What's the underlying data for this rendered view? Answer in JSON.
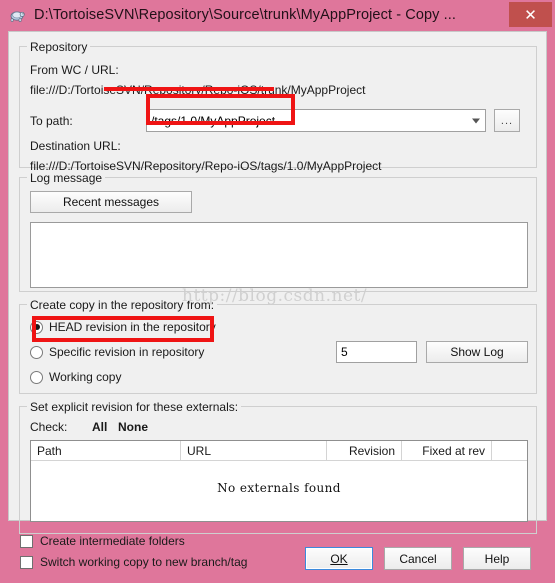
{
  "window": {
    "title": "D:\\TortoiseSVN\\Repository\\Source\\trunk\\MyAppProject - Copy ...",
    "icon": "tortoise-svn-icon",
    "close_label": "✕",
    "titlebar_color": "#df769b",
    "close_button_color": "#c0504d"
  },
  "repository": {
    "legend": "Repository",
    "from_label": "From WC / URL:",
    "from_value": "file:///D:/TortoiseSVN/Repository/Repo-iOS/trunk/MyAppProject",
    "to_path_label": "To path:",
    "to_path_value": "/tags/1.0/MyAppProject",
    "browse_label": "...",
    "destination_label": "Destination URL:",
    "destination_value": "file:///D:/TortoiseSVN/Repository/Repo-iOS/tags/1.0/MyAppProject"
  },
  "log_message": {
    "legend": "Log message",
    "recent_messages_label": "Recent messages",
    "text": "",
    "placeholder": ""
  },
  "create_copy": {
    "legend": "Create copy in the repository from:",
    "options": [
      {
        "label": "HEAD revision in the repository",
        "checked": true
      },
      {
        "label": "Specific revision in repository",
        "checked": false
      },
      {
        "label": "Working copy",
        "checked": false
      }
    ],
    "revision_value": "5",
    "show_log_label": "Show Log"
  },
  "externals": {
    "legend": "Set explicit revision for these externals:",
    "check_label": "Check:",
    "check_all_label": "All",
    "check_none_label": "None",
    "columns": [
      "Path",
      "URL",
      "Revision",
      "Fixed at rev"
    ],
    "rows": [],
    "empty_text": "No externals found"
  },
  "footer": {
    "checkboxes": [
      {
        "label": "Create intermediate folders",
        "checked": false
      },
      {
        "label": "Switch working copy to new branch/tag",
        "checked": false
      }
    ],
    "ok_label": "OK",
    "cancel_label": "Cancel",
    "help_label": "Help"
  },
  "watermark": {
    "text": "http://blog.csdn.net/"
  },
  "annotations": {
    "highlight_color": "#ef1414"
  }
}
